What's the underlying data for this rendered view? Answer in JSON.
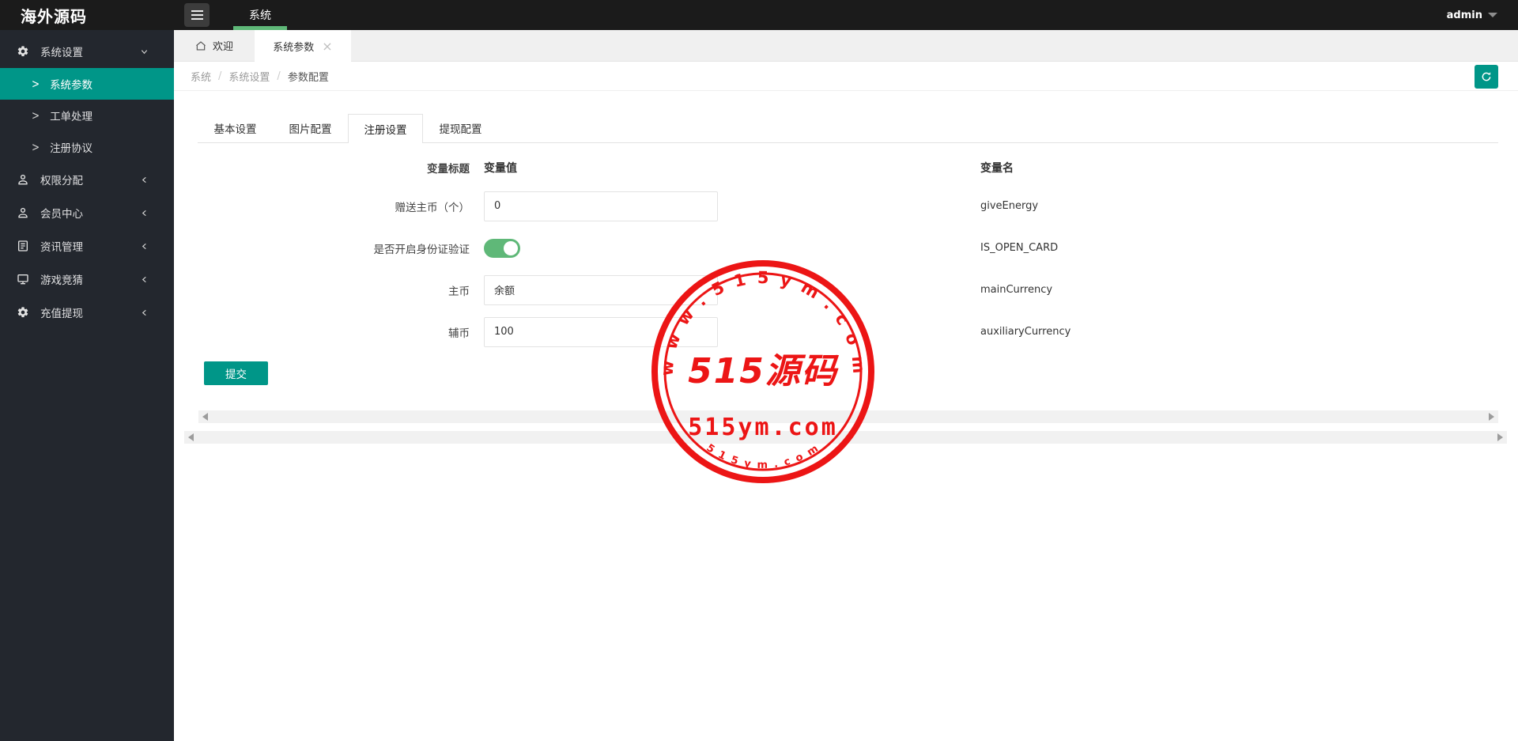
{
  "topbar": {
    "logo": "海外源码",
    "nav_tab": "系统",
    "user": "admin"
  },
  "sidebar": {
    "group_settings": {
      "label": "系统设置",
      "expanded": true
    },
    "sub_items": [
      {
        "label": "系统参数",
        "active": true
      },
      {
        "label": "工单处理",
        "active": false
      },
      {
        "label": "注册协议",
        "active": false
      }
    ],
    "items": [
      {
        "label": "权限分配"
      },
      {
        "label": "会员中心"
      },
      {
        "label": "资讯管理"
      },
      {
        "label": "游戏竞猜"
      },
      {
        "label": "充值提现"
      }
    ],
    "sub_arrow": ">"
  },
  "tabstrip": {
    "home_tab": "欢迎",
    "active_tab": "系统参数",
    "close": "×"
  },
  "breadcrumb": {
    "items": [
      "系统",
      "系统设置",
      "参数配置"
    ],
    "separator": "/"
  },
  "content": {
    "tabs": [
      {
        "label": "基本设置",
        "active": false
      },
      {
        "label": "图片配置",
        "active": false
      },
      {
        "label": "注册设置",
        "active": true
      },
      {
        "label": "提现配置",
        "active": false
      }
    ],
    "headers": {
      "title": "变量标题",
      "value": "变量值",
      "name": "变量名"
    },
    "rows": [
      {
        "title": "赠送主币（个）",
        "type": "input",
        "value": "0",
        "name": "giveEnergy"
      },
      {
        "title": "是否开启身份证验证",
        "type": "switch",
        "value": "on",
        "name": "IS_OPEN_CARD"
      },
      {
        "title": "主币",
        "type": "input",
        "value": "余额",
        "name": "mainCurrency"
      },
      {
        "title": "辅币",
        "type": "input",
        "value": "100",
        "name": "auxiliaryCurrency"
      }
    ],
    "submit_label": "提交"
  },
  "watermark": {
    "arc_top": "w w w . 5 1 5 y m . c o m",
    "center": "515源码",
    "subtitle": "515ym.com",
    "arc_bottom": "5 1 5 y m . c o m",
    "color": "#ec1515"
  },
  "colors": {
    "accent_teal": "#009688",
    "accent_green": "#5FB878",
    "topbar_bg": "#1b1b1b",
    "sidebar_bg": "#23272e"
  }
}
